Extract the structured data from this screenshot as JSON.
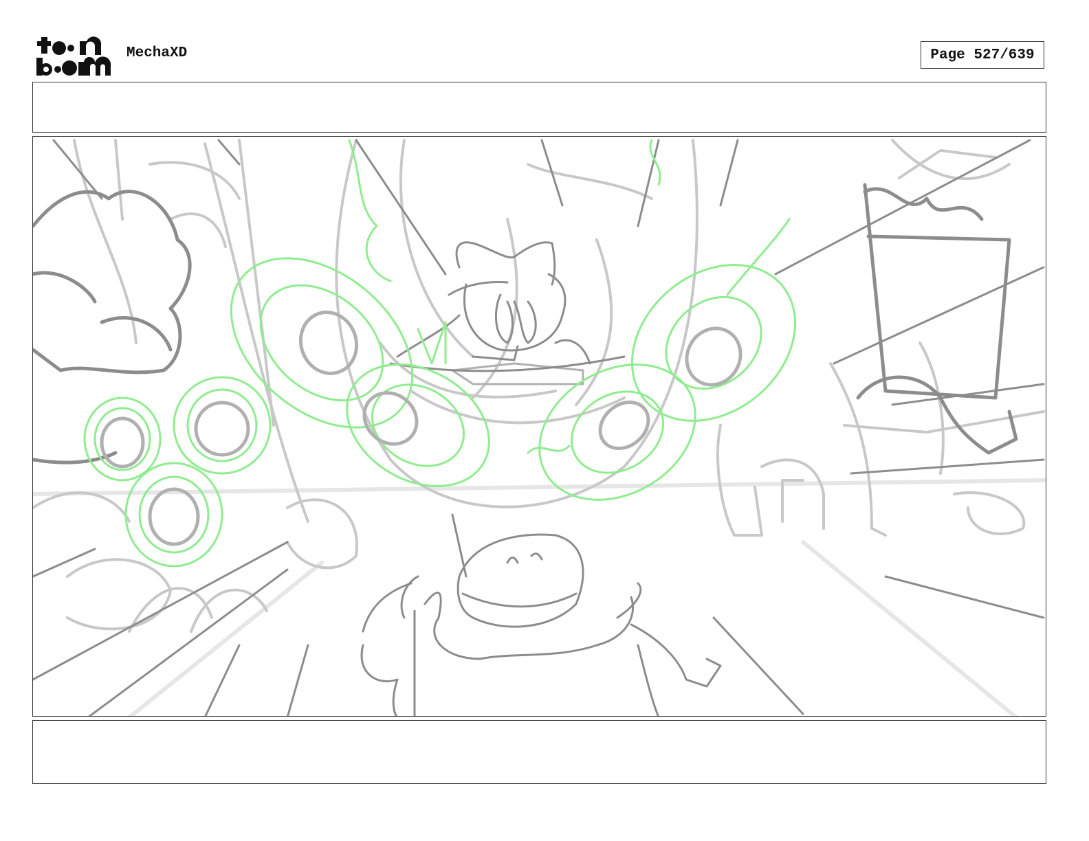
{
  "header": {
    "logo_line1": "toon",
    "logo_line2": "boom",
    "project_title": "MechaXD",
    "page_indicator": "Page 527/639"
  },
  "panel": {
    "action_notes": "",
    "dialogue_notes": ""
  },
  "colors": {
    "sketch_dark": "#888888",
    "sketch_light": "#c8c8c8",
    "sketch_green": "#90ee90",
    "border": "#333333"
  }
}
